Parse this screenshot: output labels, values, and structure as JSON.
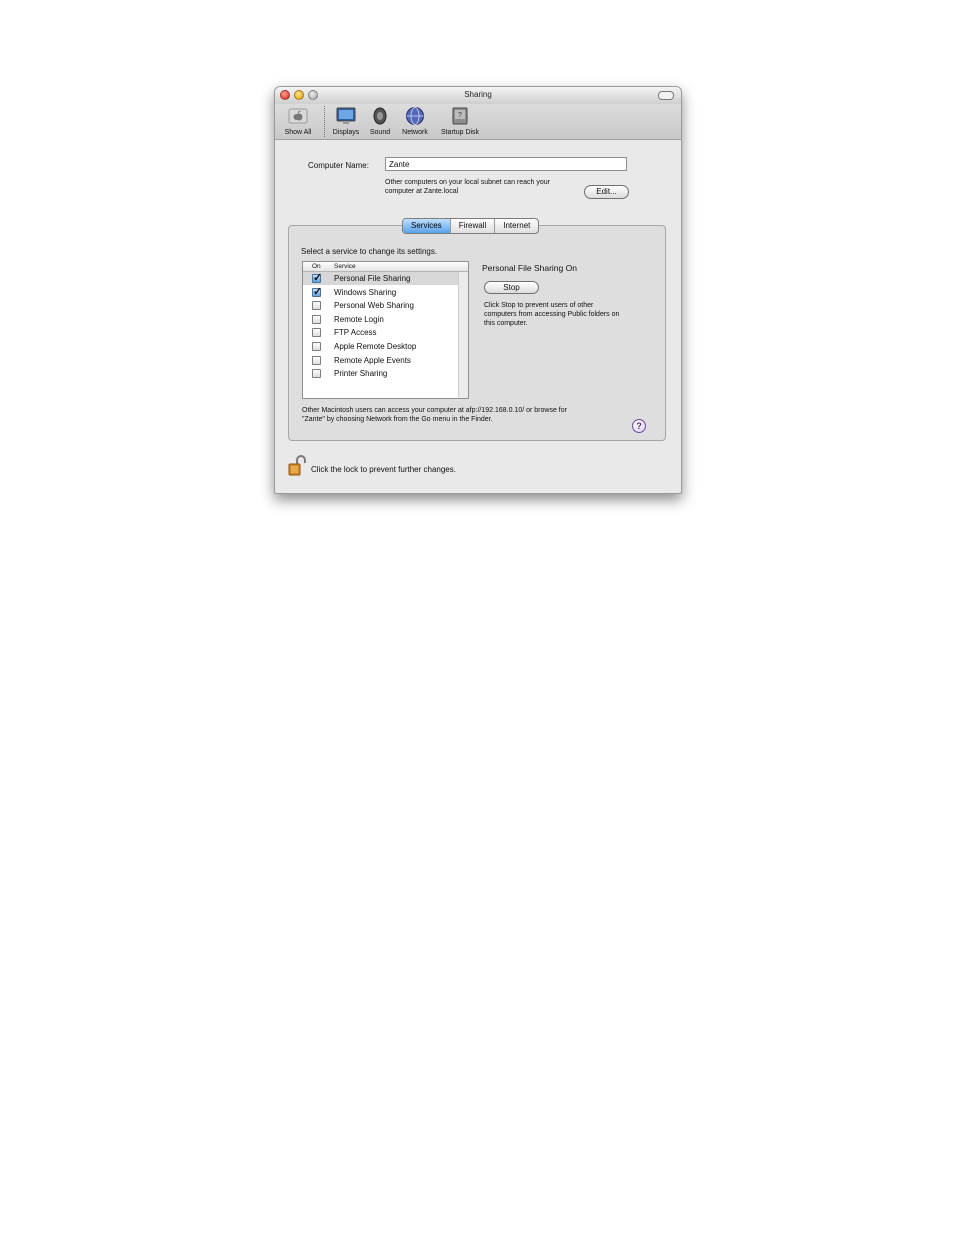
{
  "window": {
    "title": "Sharing"
  },
  "toolbar": {
    "items": [
      {
        "label": "Show All",
        "icon": "apple-icon"
      },
      {
        "label": "Displays",
        "icon": "display-icon"
      },
      {
        "label": "Sound",
        "icon": "speaker-icon"
      },
      {
        "label": "Network",
        "icon": "globe-icon"
      },
      {
        "label": "Startup Disk",
        "icon": "disk-icon"
      }
    ]
  },
  "computer_name": {
    "label": "Computer Name:",
    "value": "Zante",
    "info_line1": "Other computers on your local subnet can reach your",
    "info_line2": "computer at Zante.local",
    "edit_label": "Edit..."
  },
  "tabs": [
    {
      "label": "Services",
      "active": true
    },
    {
      "label": "Firewall",
      "active": false
    },
    {
      "label": "Internet",
      "active": false
    }
  ],
  "services": {
    "instruction": "Select a service to change its settings.",
    "col_on": "On",
    "col_service": "Service",
    "items": [
      {
        "name": "Personal File Sharing",
        "on": true,
        "selected": true
      },
      {
        "name": "Windows Sharing",
        "on": true,
        "selected": false
      },
      {
        "name": "Personal Web Sharing",
        "on": false,
        "selected": false
      },
      {
        "name": "Remote Login",
        "on": false,
        "selected": false
      },
      {
        "name": "FTP Access",
        "on": false,
        "selected": false
      },
      {
        "name": "Apple Remote Desktop",
        "on": false,
        "selected": false
      },
      {
        "name": "Remote Apple Events",
        "on": false,
        "selected": false
      },
      {
        "name": "Printer Sharing",
        "on": false,
        "selected": false
      }
    ]
  },
  "status": {
    "title": "Personal File Sharing On",
    "button": "Stop",
    "desc1": "Click Stop to prevent users of other",
    "desc2": "computers from accessing Public folders on",
    "desc3": "this computer."
  },
  "footer_note": {
    "line1": "Other Macintosh users can access your computer at afp://192.168.0.10/ or browse for",
    "line2": "\"Zante\" by choosing Network from the Go menu in the Finder."
  },
  "help": {
    "symbol": "?"
  },
  "lock": {
    "text": "Click the lock to prevent further changes."
  }
}
